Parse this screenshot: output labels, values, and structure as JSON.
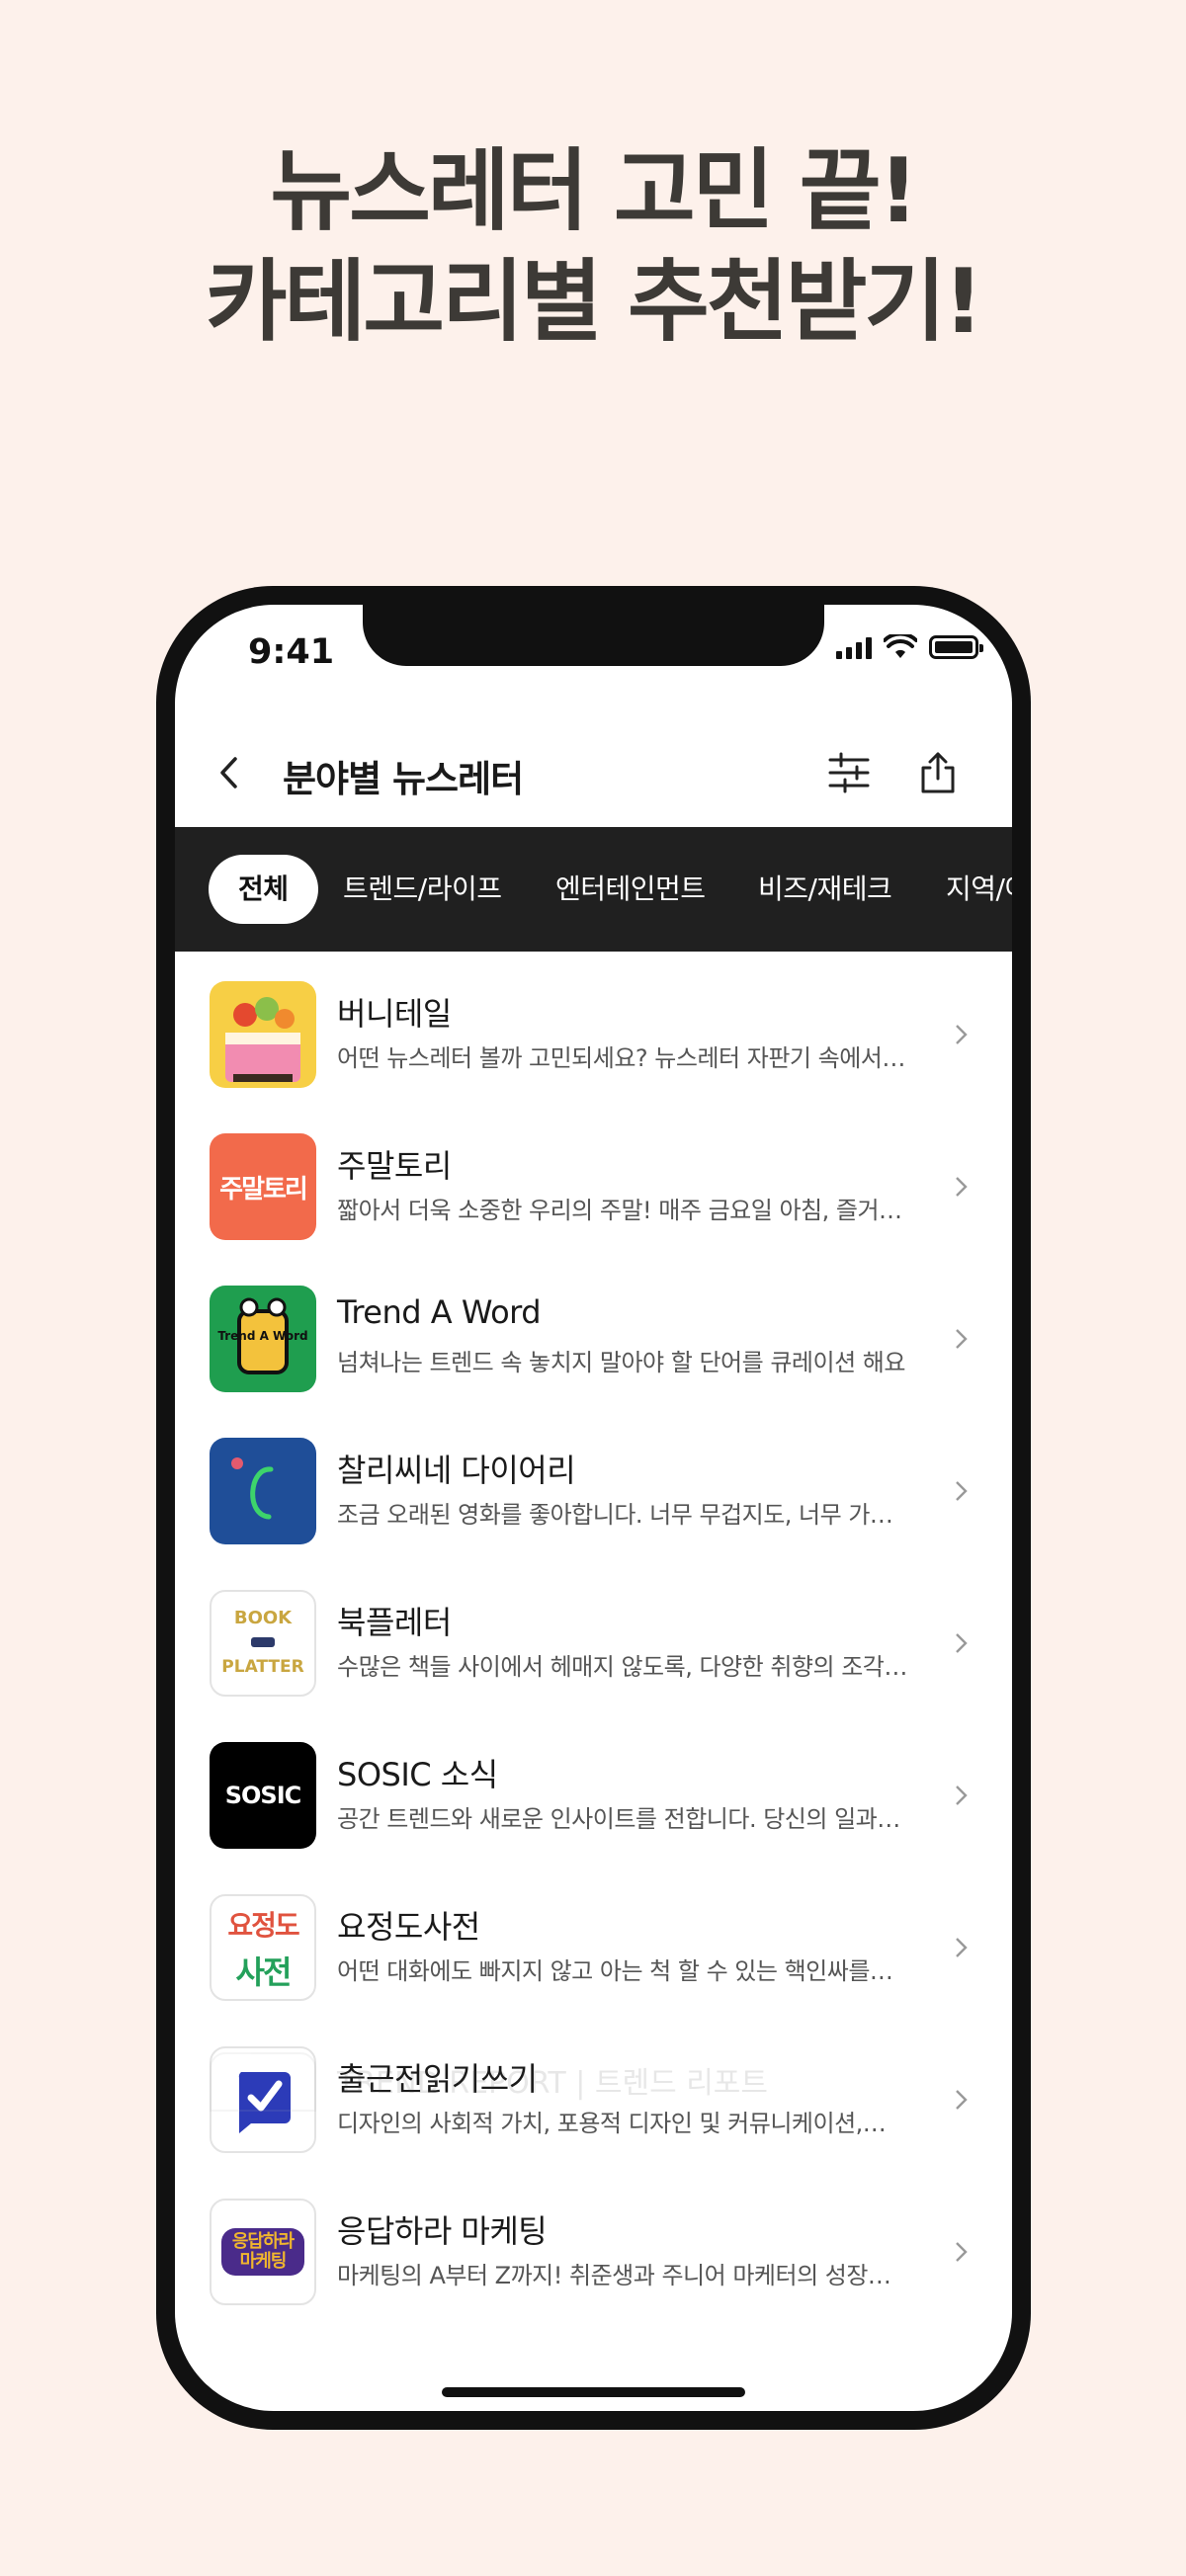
{
  "headline": {
    "line1": "뉴스레터 고민 끝!",
    "line2": "카테고리별 추천받기!"
  },
  "status": {
    "time": "9:41"
  },
  "nav": {
    "title": "분야별 뉴스레터",
    "back_icon": "chevron-left-icon",
    "filter_icon": "sliders-icon",
    "share_icon": "share-icon"
  },
  "tabs": [
    {
      "label": "전체",
      "active": true
    },
    {
      "label": "트렌드/라이프"
    },
    {
      "label": "엔터테인먼트"
    },
    {
      "label": "비즈/재테크"
    },
    {
      "label": "지역/여행"
    }
  ],
  "items": [
    {
      "title": "버니테일",
      "desc": "어떤 뉴스레터 볼까 고민되세요? 뉴스레터 자판기 속에서…"
    },
    {
      "title": "주말토리",
      "desc": "짧아서 더욱 소중한 우리의 주말!  매주 금요일 아침, 즐거…"
    },
    {
      "title": "Trend A Word",
      "desc": "넘쳐나는 트렌드 속 놓치지 말아야 할 단어를 큐레이션 해요"
    },
    {
      "title": "찰리씨네 다이어리",
      "desc": "조금 오래된 영화를 좋아합니다. 너무 무겁지도, 너무 가…"
    },
    {
      "title": "북플레터",
      "desc": "수많은 책들 사이에서 헤매지 않도록, 다양한 취향의 조각…"
    },
    {
      "title": "SOSIC 소식",
      "desc": "공간 트렌드와 새로운 인사이트를 전합니다. 당신의 일과…"
    },
    {
      "title": "요정도사전",
      "desc": "어떤 대화에도 빠지지 않고 아는 척 할 수 있는 핵인싸를…"
    },
    {
      "title": "출근전읽기쓰기",
      "desc": "디자인의 사회적 가치, 포용적 디자인 및 커뮤니케이션,…"
    },
    {
      "title": "응답하라 마케팅",
      "desc": "마케팅의 A부터 Z까지! 취준생과 주니어 마케터의 성장…"
    },
    {
      "title": "TREND REPORT | 트렌드 리포트"
    }
  ],
  "logos": {
    "jumaltori": "주말토리",
    "trend_a_word": "Trend A Word",
    "bookpletter_top": "BOOK",
    "bookpletter_bottom": "PLATTER",
    "sosic": "SOSIC",
    "yojeongdo_top": "요정도",
    "yojeongdo_bottom": "사전",
    "response_marketing": "응답하라 마케팅"
  },
  "colors": {
    "background": "#fdf1eb",
    "tab_bar": "#202020",
    "headline": "#3d3a36"
  }
}
